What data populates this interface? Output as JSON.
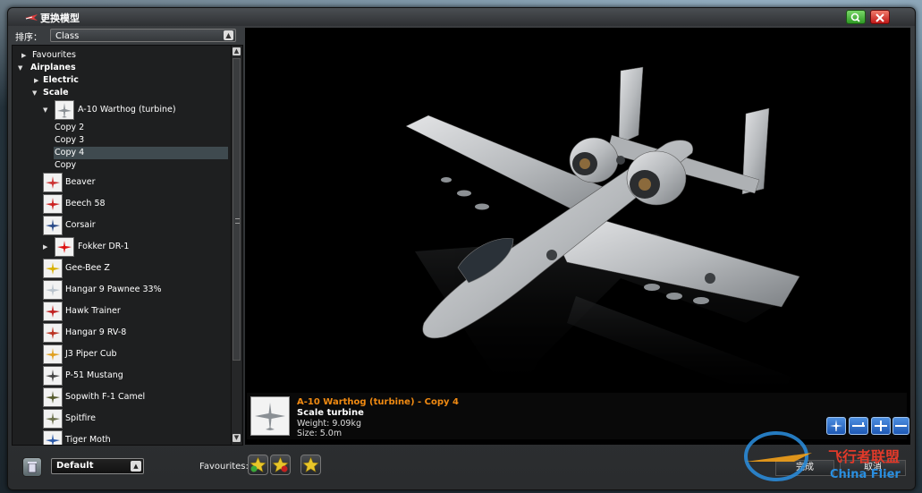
{
  "window": {
    "title": "更换模型"
  },
  "sort": {
    "label": "排序：",
    "value": "Class"
  },
  "tree": {
    "favourites": "Favourites",
    "airplanes": "Airplanes",
    "electric": "Electric",
    "scale": "Scale",
    "a10": "A-10 Warthog (turbine)",
    "copies": [
      "Copy 2",
      "Copy 3",
      "Copy 4",
      "Copy"
    ],
    "models": [
      "Beaver",
      "Beech 58",
      "Corsair",
      "Fokker DR-1",
      "Gee-Bee Z",
      "Hangar 9 Pawnee 33%",
      "Hawk Trainer",
      "Hangar 9 RV-8",
      "J3 Piper Cub",
      "P-51 Mustang",
      "Sopwith F-1 Camel",
      "Spitfire",
      "Tiger Moth"
    ]
  },
  "info": {
    "title": "A-10 Warthog (turbine) - Copy 4",
    "subtitle": "Scale turbine",
    "weight": "Weight: 9.09kg",
    "size": "Size: 5.0m"
  },
  "bottom": {
    "preset": "Default",
    "favourites_label": "Favourites:",
    "ok": "完成",
    "cancel": "取消"
  },
  "watermark": {
    "cn": "飞行者联盟",
    "en": "China Flier"
  },
  "colors": {
    "title_accent": "#f08a12",
    "selection": "#3f4a4f",
    "view_button": "#2f6fd0"
  }
}
